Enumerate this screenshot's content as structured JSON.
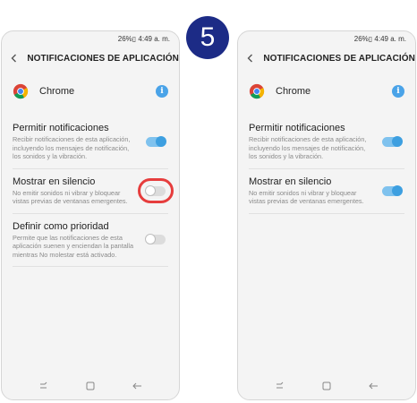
{
  "step_number": "5",
  "status_bar": {
    "text": "26%▯ 4:49 a. m."
  },
  "header": {
    "title": "NOTIFICACIONES DE APLICACIÓN"
  },
  "app": {
    "name": "Chrome",
    "info_icon": "i"
  },
  "colors": {
    "switch_on": "#3d9fe0",
    "highlight": "#e63d3d",
    "step_badge": "#1c2b86"
  },
  "left_screen": {
    "settings": [
      {
        "title": "Permitir notificaciones",
        "description": "Recibir notificaciones de esta aplicación, incluyendo los mensajes de notificación, los sonidos y la vibración.",
        "state": "on"
      },
      {
        "title": "Mostrar en silencio",
        "description": "No emitir sonidos ni vibrar y bloquear vistas previas de ventanas emergentes.",
        "state": "off",
        "highlighted": true
      },
      {
        "title": "Definir como prioridad",
        "description": "Permite que las notificaciones de esta aplicación suenen y enciendan la pantalla mientras No molestar está activado.",
        "state": "off"
      }
    ]
  },
  "right_screen": {
    "settings": [
      {
        "title": "Permitir notificaciones",
        "description": "Recibir notificaciones de esta aplicación, incluyendo los mensajes de notificación, los sonidos y la vibración.",
        "state": "on"
      },
      {
        "title": "Mostrar en silencio",
        "description": "No emitir sonidos ni vibrar y bloquear vistas previas de ventanas emergentes.",
        "state": "on"
      }
    ]
  }
}
